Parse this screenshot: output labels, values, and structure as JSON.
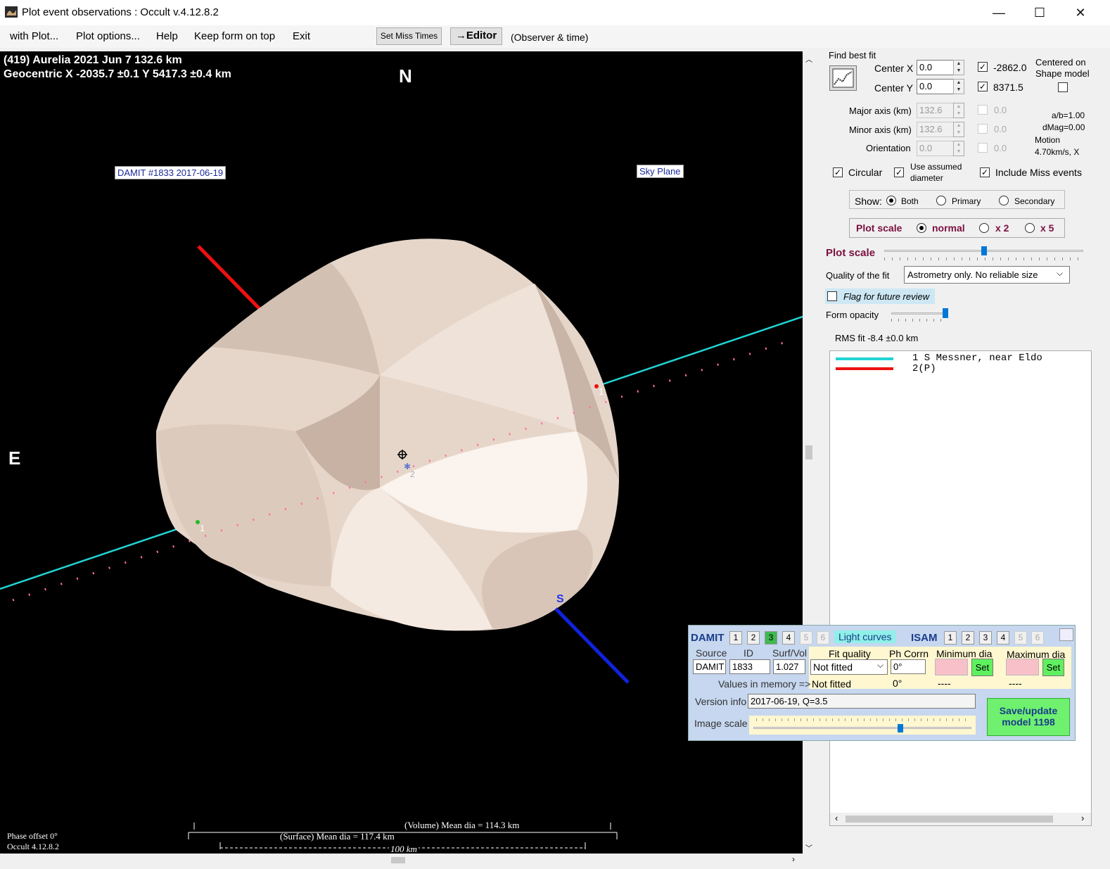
{
  "window": {
    "title": "Plot event observations : Occult v.4.12.8.2",
    "minimize": "—",
    "maximize": "☐",
    "close": "✕"
  },
  "menu": {
    "items": [
      "with Plot...",
      "Plot options...",
      "Help",
      "Keep form on top",
      "Exit"
    ],
    "set_miss_times": "Set Miss Times",
    "editor": "→Editor",
    "observer_time": "(Observer & time)"
  },
  "plot": {
    "header_line1": "(419) Aurelia  2021 Jun 7   132.6 km",
    "header_line2": "Geocentric  X  -2035.7 ±0.1  Y 5417.3 ±0.4 km",
    "north": "N",
    "east": "E",
    "south_marker": "S",
    "damit_label": "DAMIT #1833 2017-06-19",
    "sky_plane_label": "Sky Plane",
    "chord_label_1": "1",
    "chord_label_1b": "1",
    "chord_label_2": "2",
    "phase_offset": "Phase offset 0°",
    "version": "Occult 4.12.8.2",
    "volume_mean": "(Volume) Mean dia = 114.3 km",
    "surface_mean": "(Surface) Mean dia = 117.4 km",
    "scale_100": "100 km"
  },
  "panel": {
    "find_best_fit": "Find best fit",
    "center_x_label": "Center X",
    "center_x": "0.0",
    "center_y_label": "Center Y",
    "center_y": "0.0",
    "center_x_fit": "-2862.0",
    "center_y_fit": "8371.5",
    "centered_on": "Centered on",
    "shape_model": "Shape model",
    "major_axis_label": "Major axis (km)",
    "major_axis": "132.6",
    "minor_axis_label": "Minor axis (km)",
    "minor_axis": "132.6",
    "orientation_label": "Orientation",
    "orientation": "0.0",
    "major_fit": "0.0",
    "minor_fit": "0.0",
    "orient_fit": "0.0",
    "ab_ratio": "a/b=1.00",
    "dmag": "dMag=0.00",
    "motion_label": "Motion",
    "motion": "4.70km/s, X",
    "circular": "Circular",
    "use_assumed": "Use assumed",
    "diameter": "diameter",
    "include_miss": "Include Miss events",
    "show_label": "Show:",
    "show_both": "Both",
    "show_primary": "Primary",
    "show_secondary": "Secondary",
    "plot_scale_label": "Plot scale",
    "scale_normal": "normal",
    "scale_x2": "x 2",
    "scale_x5": "x 5",
    "plot_scale_slider_label": "Plot scale",
    "quality_label": "Quality of the fit",
    "quality_value": "Astrometry only. No reliable size",
    "flag_review": "Flag for future review",
    "form_opacity": "Form opacity",
    "rms_fit": "RMS fit -8.4 ±0.0 km",
    "legend_row1": "1    S Messner, near Eldo",
    "legend_row2": "2(P)"
  },
  "damit": {
    "title": "DAMIT",
    "tabs": [
      "1",
      "2",
      "3",
      "4",
      "5",
      "6"
    ],
    "light_curves": "Light curves",
    "isam": "ISAM",
    "isam_tabs": [
      "1",
      "2",
      "3",
      "4",
      "5",
      "6"
    ],
    "source_label": "Source",
    "id_label": "ID",
    "surfvol_label": "Surf/Vol",
    "fit_quality_label": "Fit quality",
    "ph_corr_label": "Ph Corrn",
    "min_dia_label": "Minimum dia",
    "max_dia_label": "Maximum dia",
    "source": "DAMIT",
    "id": "1833",
    "surfvol": "1.027",
    "fit_quality": "Not fitted",
    "ph_corr": "0°",
    "set": "Set",
    "values_in_memory": "Values in memory =>",
    "mem_fit_quality": "Not fitted",
    "mem_ph_corr": "0°",
    "mem_min": "----",
    "mem_max": "----",
    "version_info_label": "Version info",
    "version_info": "2017-06-19, Q=3.5",
    "image_scale_label": "Image scale",
    "save_update": "Save/update",
    "model": "model 1198"
  },
  "colors": {
    "chord_cyan": "#22d3d3",
    "axis_red": "#ee1111",
    "axis_blue": "#1122dd",
    "path_pink": "#ff6fa0",
    "asteroid_fill": "#eadbd0",
    "plot_scale_maroon": "#7a1040",
    "damit_panel": "#c6d7ef"
  }
}
